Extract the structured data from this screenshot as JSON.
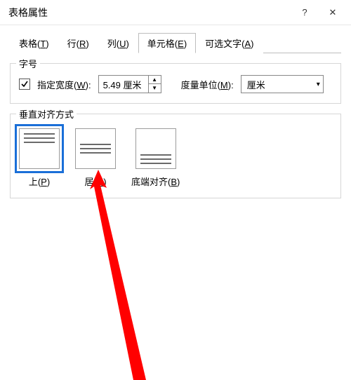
{
  "titlebar": {
    "title": "表格属性",
    "help": "?",
    "close": "✕"
  },
  "tabs": {
    "table": {
      "pre": "表格(",
      "key": "T",
      "post": ")"
    },
    "row": {
      "pre": "行(",
      "key": "R",
      "post": ")"
    },
    "column": {
      "pre": "列(",
      "key": "U",
      "post": ")"
    },
    "cell": {
      "pre": "单元格(",
      "key": "E",
      "post": ")"
    },
    "alt": {
      "pre": "可选文字(",
      "key": "A",
      "post": ")"
    }
  },
  "size": {
    "legend": "字号",
    "specify": {
      "pre": "指定宽度(",
      "key": "W",
      "post": "):",
      "checked": true
    },
    "width_value": "5.49 厘米",
    "unit_label": {
      "pre": "度量单位(",
      "key": "M",
      "post": "):"
    },
    "unit_value": "厘米"
  },
  "valign": {
    "legend": "垂直对齐方式",
    "top": {
      "pre": "上(",
      "key": "P",
      "post": ")"
    },
    "center": {
      "pre": "居",
      "gap": "(",
      "key": "C",
      "post": ")"
    },
    "bottom": {
      "pre": "底端对齐(",
      "key": "B",
      "post": ")"
    }
  }
}
